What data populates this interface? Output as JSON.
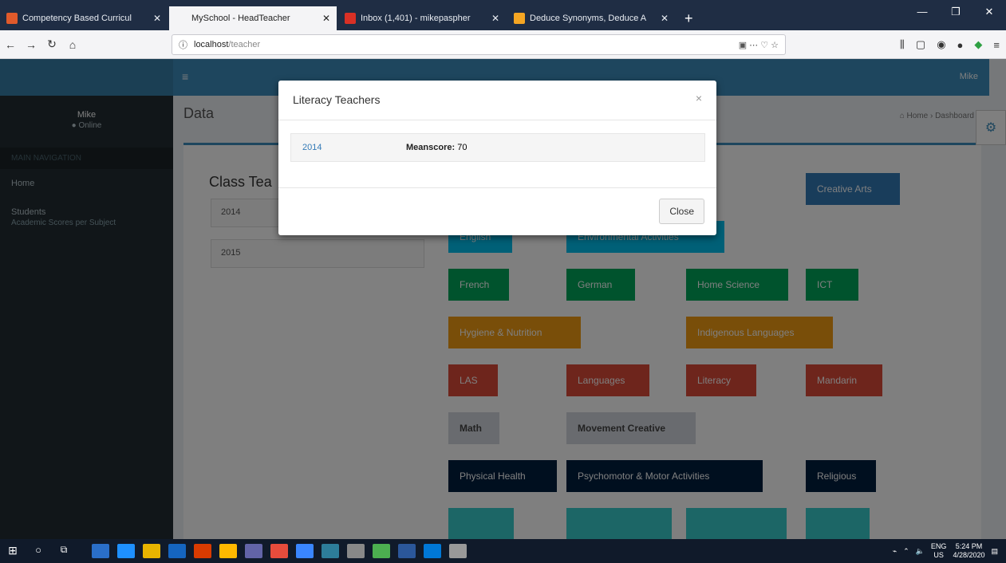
{
  "browser": {
    "tabs": [
      {
        "title": "Competency Based Curricul",
        "fav": "#e05a2b",
        "active": false
      },
      {
        "title": "MySchool - HeadTeacher",
        "fav": "#f4f4f6",
        "active": true
      },
      {
        "title": "Inbox (1,401) - mikepaspher",
        "fav": "#d93025",
        "active": false
      },
      {
        "title": "Deduce Synonyms, Deduce A",
        "fav": "#f5a623",
        "active": false
      }
    ],
    "new_tab": "+",
    "url_host": "localhost",
    "url_path": "/teacher",
    "url_actions": "▣   ⋯  ♡  ☆",
    "window_controls": [
      "—",
      "❐",
      "✕"
    ]
  },
  "app": {
    "user_name": "Mike",
    "user_role": "● Online",
    "topbar_user": "Mike",
    "menu_header": "MAIN NAVIGATION",
    "nav_home": "Home",
    "nav_students": "Students",
    "nav_students_sub": "Academic Scores per Subject",
    "page_title": "Data",
    "breadcrumb": "⌂ Home  ›  Dashboard",
    "box_title": "Class Tea",
    "years": [
      "2014",
      "2015"
    ]
  },
  "subjects": [
    {
      "name": "Creative Arts",
      "color": "c-blue"
    },
    {
      "name": "English",
      "color": "c-cyan"
    },
    {
      "name": "Environmental Activities",
      "color": "c-cyan"
    },
    {
      "name": "French",
      "color": "c-green"
    },
    {
      "name": "German",
      "color": "c-green"
    },
    {
      "name": "Home Science",
      "color": "c-green"
    },
    {
      "name": "ICT",
      "color": "c-green"
    },
    {
      "name": "Hygiene & Nutrition",
      "color": "c-yellow"
    },
    {
      "name": "Indigenous Languages",
      "color": "c-yellow"
    },
    {
      "name": "LAS",
      "color": "c-red"
    },
    {
      "name": "Languages",
      "color": "c-red"
    },
    {
      "name": "Literacy",
      "color": "c-red"
    },
    {
      "name": "Mandarin",
      "color": "c-red"
    },
    {
      "name": "Math",
      "color": "c-gray"
    },
    {
      "name": "Movement Creative",
      "color": "c-gray"
    },
    {
      "name": "Physical Health",
      "color": "c-navy"
    },
    {
      "name": "Psychomotor & Motor Activities",
      "color": "c-navy"
    },
    {
      "name": "Religious",
      "color": "c-navy"
    },
    {
      "name": "",
      "color": "c-teal"
    },
    {
      "name": "",
      "color": "c-teal"
    },
    {
      "name": "",
      "color": "c-teal"
    },
    {
      "name": "",
      "color": "c-teal"
    }
  ],
  "modal": {
    "title": "Literacy Teachers",
    "close_x": "×",
    "row_year": "2014",
    "row_label": "Meanscore:",
    "row_value": " 70",
    "close_button": "Close"
  },
  "taskbar": {
    "lang": "ENG",
    "region": "US",
    "time": "5:24 PM",
    "date": "4/28/2020",
    "app_colors": [
      "#2a6fc9",
      "#1e90ff",
      "#e8b400",
      "#1565c0",
      "#d83b01",
      "#ffb900",
      "#6264a7",
      "#e74c3c",
      "#3a86ff",
      "#2d7d9a",
      "#888",
      "#4caf50",
      "#2b579a",
      "#0078d7",
      "#999"
    ]
  }
}
